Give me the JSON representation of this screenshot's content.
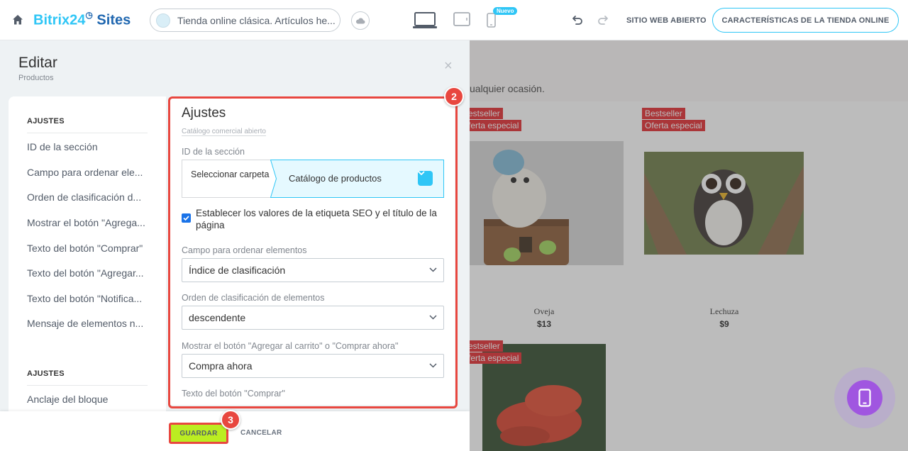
{
  "topbar": {
    "brand_part1": "Bitrix24",
    "brand_part2": "Sites",
    "site_name": "Tienda online clásica. Artículos he...",
    "new_badge": "Nuevo",
    "open_site": "SITIO WEB ABIERTO",
    "features_button": "CARACTERÍSTICAS DE LA TIENDA ONLINE",
    "icons": [
      "home-icon",
      "cloud-icon",
      "desktop-icon",
      "tablet-icon",
      "mobile-icon",
      "undo-icon",
      "redo-icon"
    ]
  },
  "panel": {
    "title": "Editar",
    "subtitle": "Productos",
    "close": "×"
  },
  "sidebar": {
    "section1": "AJUSTES",
    "items": [
      "ID de la sección",
      "Campo para ordenar ele...",
      "Orden de clasificación d...",
      "Mostrar el botón \"Agrega...",
      "Texto del botón \"Comprar\"",
      "Texto del botón \"Agregar...",
      "Texto del botón \"Notifica...",
      "Mensaje de elementos n..."
    ],
    "section2": "AJUSTES",
    "items2": [
      "Anclaje del bloque"
    ]
  },
  "form": {
    "title": "Ajustes",
    "catalog_link": "Catálogo comercial abierto",
    "section_id_label": "ID de la sección",
    "folder_select": "Seleccionar carpeta",
    "folder_value": "Catálogo de productos",
    "seo_checkbox": "Establecer los valores de la etiqueta SEO y el título de la página",
    "seo_checked": true,
    "sort_field_label": "Campo para ordenar elementos",
    "sort_field_value": "Índice de clasificación",
    "sort_order_label": "Orden de clasificación de elementos",
    "sort_order_value": "descendente",
    "show_button_label": "Mostrar el botón \"Agregar al carrito\" o \"Comprar ahora\"",
    "show_button_value": "Compra ahora",
    "buy_text_label": "Texto del botón \"Comprar\""
  },
  "footer": {
    "save": "GUARDAR",
    "cancel": "CANCELAR"
  },
  "markers": {
    "form_marker": "2",
    "save_marker": "3"
  },
  "preview": {
    "intro_text": "ualquier ocasión.",
    "products": [
      {
        "tags": [
          "estseller",
          "ferta especial"
        ],
        "name": "Oveja",
        "price": "$13"
      },
      {
        "tags": [
          "Bestseller",
          "Oferta especial"
        ],
        "name": "Lechuza",
        "price": "$9"
      },
      {
        "tags": [
          "estseller",
          "ferta especial"
        ]
      }
    ]
  },
  "colors": {
    "accent": "#2fc6f6",
    "brand_dark": "#2067b0",
    "highlight_red": "#e8473f",
    "save_green": "#bbed21",
    "tag_red": "#e3272d",
    "mobile_purple": "#a056e0"
  }
}
